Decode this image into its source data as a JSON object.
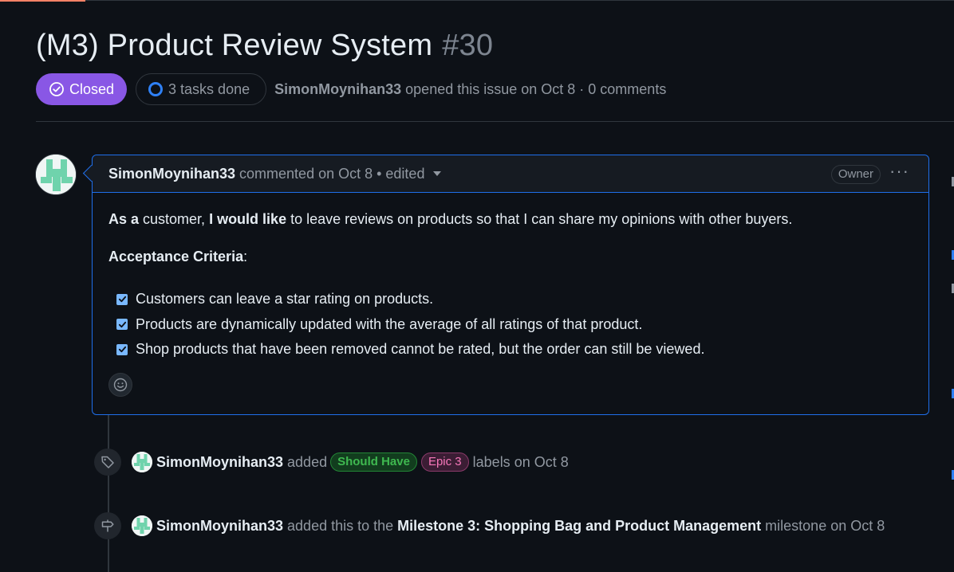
{
  "issue": {
    "title": "(M3) Product Review System",
    "number": "#30",
    "state": "Closed",
    "tasks": "3 tasks done",
    "author": "SimonMoynihan33",
    "opened_text": "opened this issue on Oct 8 · 0 comments"
  },
  "comment": {
    "author": "SimonMoynihan33",
    "meta": "commented on Oct 8 • edited",
    "owner_label": "Owner",
    "more": "···",
    "p1_bold1": "As a",
    "p1_text1": " customer, ",
    "p1_bold2": "I would like",
    "p1_text2": " to leave reviews on products so that I can share my opinions with other buyers.",
    "criteria_heading": "Acceptance Criteria",
    "criteria_colon": ":",
    "tasks": [
      "Customers can leave a star rating on products.",
      "Products are dynamically updated with the average of all ratings of that product.",
      "Shop products that have been removed cannot be rated, but the order can still be viewed."
    ]
  },
  "events": [
    {
      "actor": "SimonMoynihan33",
      "verb": "added",
      "labels": [
        "Should Have",
        "Epic 3"
      ],
      "suffix": "labels on Oct 8"
    },
    {
      "actor": "SimonMoynihan33",
      "prefix": "added this to the",
      "milestone": "Milestone 3: Shopping Bag and Product Management",
      "suffix": "milestone on Oct 8"
    }
  ],
  "colors": {
    "closed": "#8957e5",
    "accent": "#1f6feb",
    "label_should_have": "#3fb950",
    "label_epic": "#f778ba"
  }
}
